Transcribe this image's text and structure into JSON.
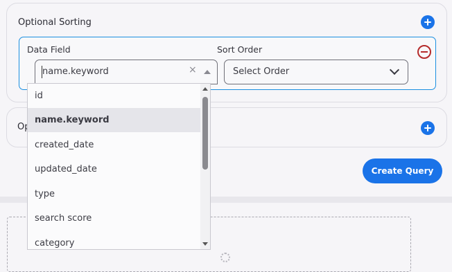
{
  "sorting": {
    "title": "Optional Sorting",
    "data_field_label": "Data Field",
    "sort_order_label": "Sort Order",
    "data_field_value": "name.keyword",
    "sort_order_placeholder": "Select Order",
    "clear_symbol": "×"
  },
  "second_section": {
    "title_visible": "Op"
  },
  "actions": {
    "create_query": "Create Query"
  },
  "dropdown": {
    "options": [
      "id",
      "name.keyword",
      "created_date",
      "updated_date",
      "type",
      "search score",
      "category"
    ],
    "selected_index": 1
  },
  "colors": {
    "accent": "#1a73e8",
    "focus_border": "#1a8fe0",
    "remove": "#b52b2b"
  },
  "icons": {
    "add": "plus-circle-icon",
    "remove": "minus-circle-icon",
    "clear": "close-icon",
    "collapse": "triangle-up-icon",
    "expand": "chevron-down-icon"
  }
}
